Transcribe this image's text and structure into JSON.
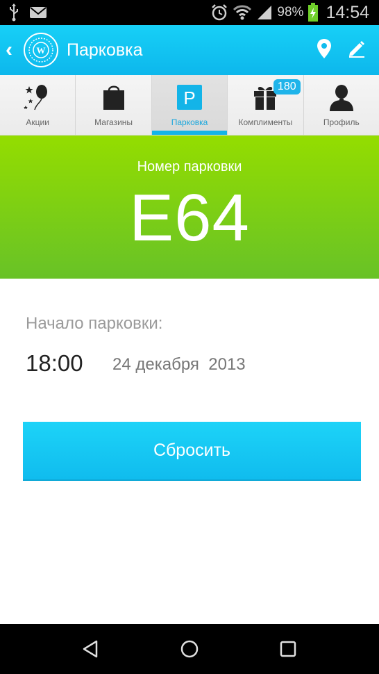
{
  "status_bar": {
    "battery_percent": "98%",
    "time": "14:54",
    "icons": [
      "usb-icon",
      "mail-icon",
      "alarm-icon",
      "wifi-icon",
      "signal-icon",
      "battery-icon"
    ]
  },
  "action_bar": {
    "title": "Парковка",
    "icons": [
      "back-chevron-icon",
      "app-logo",
      "location-pin-icon",
      "edit-pencil-icon"
    ]
  },
  "tabs": [
    {
      "label": "Акции",
      "icon": "balloon-stars-icon"
    },
    {
      "label": "Магазины",
      "icon": "shopping-bag-icon"
    },
    {
      "label": "Парковка",
      "icon": "parking-icon",
      "active": true
    },
    {
      "label": "Комплименты",
      "icon": "gift-icon",
      "badge": "180"
    },
    {
      "label": "Профиль",
      "icon": "person-icon"
    }
  ],
  "parking": {
    "label": "Номер парковки",
    "number": "E64"
  },
  "start": {
    "label": "Начало парковки:",
    "time": "18:00",
    "date": "24 декабря  2013"
  },
  "reset_button": {
    "label": "Сбросить"
  },
  "colors": {
    "accent": "#13b4e8",
    "green_top": "#94dd00",
    "green_bottom": "#68c227"
  },
  "nav_bar": {
    "icons": [
      "back-triangle-icon",
      "home-circle-icon",
      "recents-square-icon"
    ]
  }
}
